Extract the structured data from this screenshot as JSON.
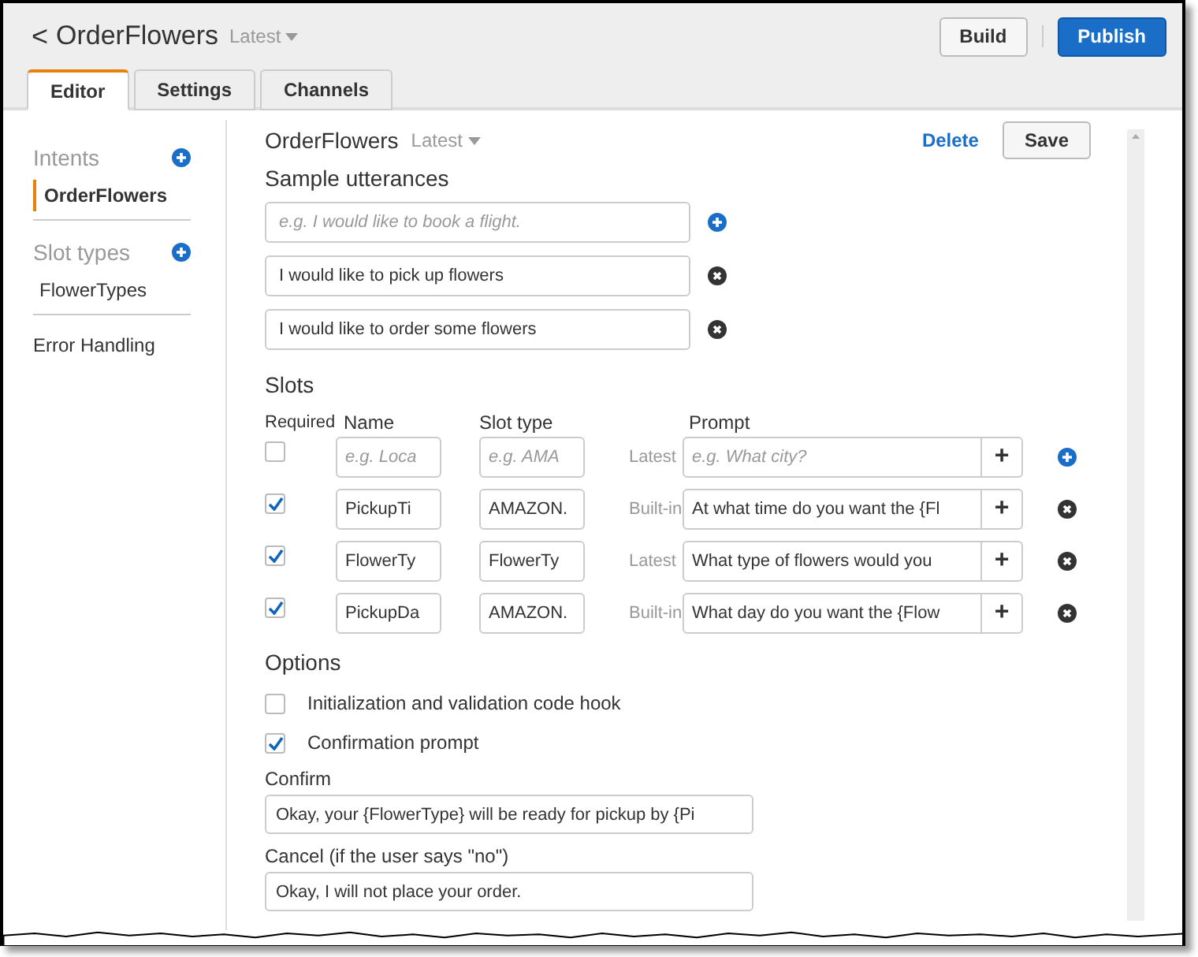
{
  "header": {
    "back": "<",
    "title": "OrderFlowers",
    "version": "Latest",
    "buttons": [
      {
        "label": "Build",
        "kind": "default"
      },
      {
        "label": "Publish",
        "kind": "primary"
      }
    ]
  },
  "tabs": [
    {
      "label": "Editor",
      "selected": true
    },
    {
      "label": "Settings",
      "selected": false
    },
    {
      "label": "Channels",
      "selected": false
    }
  ],
  "sidebar": {
    "sections": [
      {
        "title": "Intents",
        "items": [
          {
            "label": "OrderFlowers",
            "selected": true
          }
        ]
      },
      {
        "title": "Slot types",
        "items": [
          {
            "label": "FlowerTypes",
            "selected": false
          }
        ]
      }
    ],
    "footer": "Error Handling"
  },
  "intent": {
    "title": "OrderFlowers",
    "version": "Latest",
    "delete": "Delete",
    "save": "Save"
  },
  "sample_utterances": {
    "heading": "Sample utterances",
    "rows": [
      {
        "placeholder": "e.g. I would like to book a flight.",
        "kind": "add"
      },
      {
        "value": "I would like to pick up flowers",
        "kind": "remove"
      },
      {
        "value": "I would like to order some flowers",
        "kind": "remove"
      }
    ]
  },
  "slots": {
    "heading": "Slots",
    "columns": [
      "Required",
      "Name",
      "Slot type",
      "Prompt"
    ],
    "rows": [
      {
        "required": false,
        "name": {
          "placeholder": "e.g. Loca"
        },
        "slot_type": {
          "placeholder": "e.g. AMA"
        },
        "version": "Latest",
        "prompt": {
          "placeholder": "e.g. What city?"
        },
        "prompt_button": "+",
        "kind": "add"
      },
      {
        "required": true,
        "name": {
          "value": "PickupTi"
        },
        "slot_type": {
          "value": "AMAZON."
        },
        "version": "Built-in",
        "prompt": {
          "value": "At what time do you want the {Fl"
        },
        "prompt_button": "+",
        "kind": "remove"
      },
      {
        "required": true,
        "name": {
          "value": "FlowerTy"
        },
        "slot_type": {
          "value": "FlowerTy"
        },
        "version": "Latest",
        "prompt": {
          "value": "What type of flowers would you"
        },
        "prompt_button": "+",
        "kind": "remove"
      },
      {
        "required": true,
        "name": {
          "value": "PickupDa"
        },
        "slot_type": {
          "value": "AMAZON."
        },
        "version": "Built-in",
        "prompt": {
          "value": "What day do you want the {Flow"
        },
        "prompt_button": "+",
        "kind": "remove"
      }
    ]
  },
  "options": {
    "heading": "Options",
    "items": [
      {
        "label": "Initialization and validation code hook",
        "checked": false
      },
      {
        "label": "Confirmation prompt",
        "checked": true
      }
    ],
    "fields": [
      {
        "label": "Confirm",
        "value": "Okay, your {FlowerType} will be ready for pickup by {Pi"
      },
      {
        "label": "Cancel (if the user says \"no\")",
        "value": "Okay, I will not place your order."
      }
    ]
  }
}
